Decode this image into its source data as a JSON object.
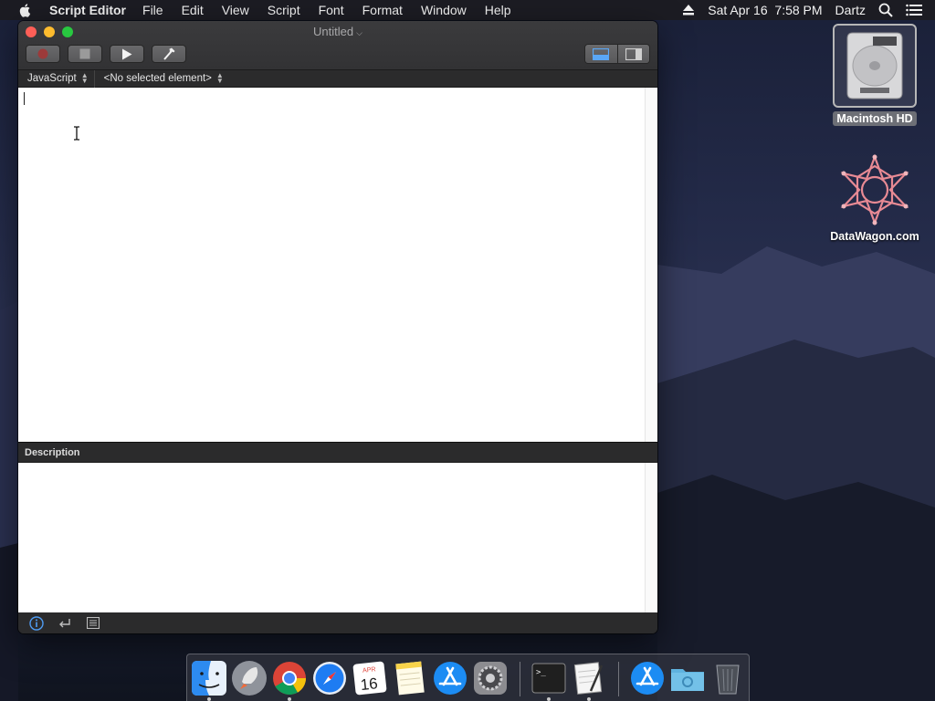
{
  "menubar": {
    "app_name": "Script Editor",
    "items": [
      "File",
      "Edit",
      "View",
      "Script",
      "Font",
      "Format",
      "Window",
      "Help"
    ],
    "datetime": "Sat Apr 16  7:58 PM",
    "user": "Dartz",
    "icons": [
      "apple-icon",
      "eject-icon",
      "spotlight-search-icon",
      "notification-center-icon"
    ]
  },
  "window": {
    "title": "Untitled",
    "toolbar": {
      "buttons": [
        "record-button",
        "stop-button",
        "run-button",
        "compile-button"
      ],
      "view_toggle": [
        "show-log-view-button",
        "show-sidebar-button"
      ]
    },
    "navigation": {
      "language": "JavaScript",
      "element": "<No selected element>"
    },
    "editor_text": "",
    "description_header": "Description",
    "description_text": "",
    "bottom_bar_icons": [
      "info-icon",
      "return-icon",
      "list-icon"
    ]
  },
  "desktop": {
    "icons": [
      {
        "label": "Macintosh HD",
        "icon": "hard-drive-icon"
      },
      {
        "label": "DataWagon.com",
        "icon": "datawagon-icon"
      }
    ]
  },
  "dock": {
    "apps": [
      "finder",
      "launchpad",
      "chrome",
      "safari",
      "calendar",
      "notes",
      "app-store",
      "system-preferences",
      "terminal",
      "script-editor",
      "app-store-downloads",
      "downloads-folder",
      "trash"
    ],
    "calendar": {
      "month": "APR",
      "day": "16"
    },
    "colors": {
      "finder": "#2d8bf0",
      "safari": "#1e7cf2",
      "chrome_red": "#db4437",
      "chrome_yellow": "#f4c20d",
      "chrome_green": "#0f9d58"
    }
  }
}
